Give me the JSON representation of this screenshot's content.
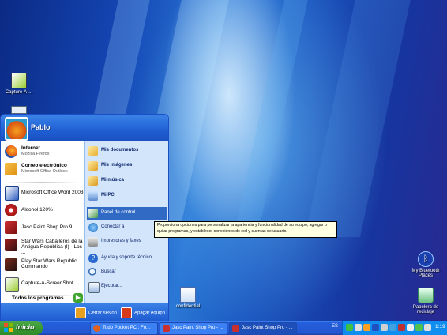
{
  "desktop": {
    "icons": [
      {
        "label": "Capture-A-...",
        "icon": "screenshot-app-icon"
      },
      {
        "label": "My Bluetooth Places",
        "icon": "bluetooth-icon"
      },
      {
        "label": "Papelera de reciclaje",
        "icon": "recycle-bin-icon"
      },
      {
        "label": "confidential",
        "icon": "document-icon"
      }
    ]
  },
  "start_menu": {
    "user": "Pablo",
    "pinned": [
      {
        "title": "Internet",
        "subtitle": "Mozilla Firefox",
        "icon": "firefox-icon"
      },
      {
        "title": "Correo electrónico",
        "subtitle": "Microsoft Office Outlook",
        "icon": "outlook-icon"
      }
    ],
    "recent": [
      {
        "title": "Microsoft Office Word 2003",
        "icon": "word-icon"
      },
      {
        "title": "Alcohol 120%",
        "icon": "alcohol-icon"
      },
      {
        "title": "Jasc Paint Shop Pro 9",
        "icon": "paint-shop-icon"
      },
      {
        "title": "Star Wars Caballeros de la Antigua República (I) - Los ...",
        "icon": "starwars-kotor-icon"
      },
      {
        "title": "Play Star Wars Republic Commando",
        "icon": "starwars-commando-icon"
      },
      {
        "title": "Capture-A-ScreenShot",
        "icon": "screenshot-app-icon"
      }
    ],
    "all_programs": "Todos los programas",
    "places": [
      {
        "label": "Mis documentos",
        "icon": "my-documents-icon",
        "bold": true
      },
      {
        "label": "Mis imágenes",
        "icon": "my-pictures-icon",
        "bold": true
      },
      {
        "label": "Mi música",
        "icon": "my-music-icon",
        "bold": true
      },
      {
        "label": "Mi PC",
        "icon": "my-computer-icon",
        "bold": true
      },
      {
        "label": "Panel de control",
        "icon": "control-panel-icon",
        "bold": false,
        "selected": true
      },
      {
        "label": "Conectar a",
        "icon": "connect-to-icon",
        "bold": false
      },
      {
        "label": "Impresoras y faxes",
        "icon": "printers-icon",
        "bold": false
      },
      {
        "label": "Ayuda y soporte técnico",
        "icon": "help-icon",
        "bold": false
      },
      {
        "label": "Buscar",
        "icon": "search-icon",
        "bold": false
      },
      {
        "label": "Ejecutar...",
        "icon": "run-icon",
        "bold": false
      }
    ],
    "logoff": "Cerrar sesión",
    "shutdown": "Apagar equipo"
  },
  "tooltip": "Proporciona opciones para personalizar la apariencia y funcionalidad de su equipo, agregar o quitar programas, y establecer conexiones de red y cuentas de usuario.",
  "taskbar": {
    "start_label": "Inicio",
    "tasks": [
      {
        "label": "Todo Pocket PC : Fo...",
        "icon": "browser-icon"
      },
      {
        "label": "Jasc Paint Shop Pro - ...",
        "icon": "paint-shop-icon"
      },
      {
        "label": "Jasc Paint Shop Pro - ...",
        "icon": "paint-shop-icon"
      }
    ],
    "tray_badge": "ES",
    "clock": "1:19"
  }
}
